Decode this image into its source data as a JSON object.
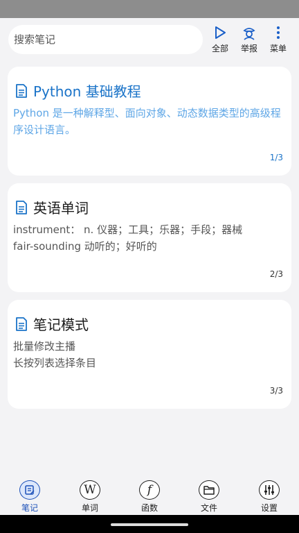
{
  "search": {
    "placeholder": "搜索笔记"
  },
  "top_actions": [
    {
      "label": "全部",
      "icon": "play-triangle-icon"
    },
    {
      "label": "举报",
      "icon": "police-officer-icon"
    },
    {
      "label": "菜单",
      "icon": "more-vertical-icon"
    }
  ],
  "notes": [
    {
      "title": "Python 基础教程",
      "lines": [
        "Python 是一种解释型、面向对象、动态数据类型的高级程序设计语言。"
      ],
      "page": "1/3",
      "active": true
    },
    {
      "title": "英语单词",
      "lines": [
        "instrument： n. 仪器；工具；乐器；手段；器械",
        "fair-sounding 动听的；好听的"
      ],
      "page": "2/3",
      "active": false
    },
    {
      "title": "笔记模式",
      "lines": [
        "批量修改主播",
        "长按列表选择条目"
      ],
      "page": "3/3",
      "active": false
    }
  ],
  "bottom_nav": [
    {
      "label": "笔记",
      "icon": "note-icon",
      "active": true
    },
    {
      "label": "单词",
      "icon": "word-w-icon",
      "glyph": "W",
      "active": false
    },
    {
      "label": "函数",
      "icon": "function-f-icon",
      "glyph": "f",
      "active": false
    },
    {
      "label": "文件",
      "icon": "folder-icon",
      "active": false
    },
    {
      "label": "设置",
      "icon": "sliders-icon",
      "active": false
    }
  ],
  "colors": {
    "accent": "#1a73c8",
    "nav_active": "#1a4fb8",
    "background": "#f3f3f5"
  }
}
